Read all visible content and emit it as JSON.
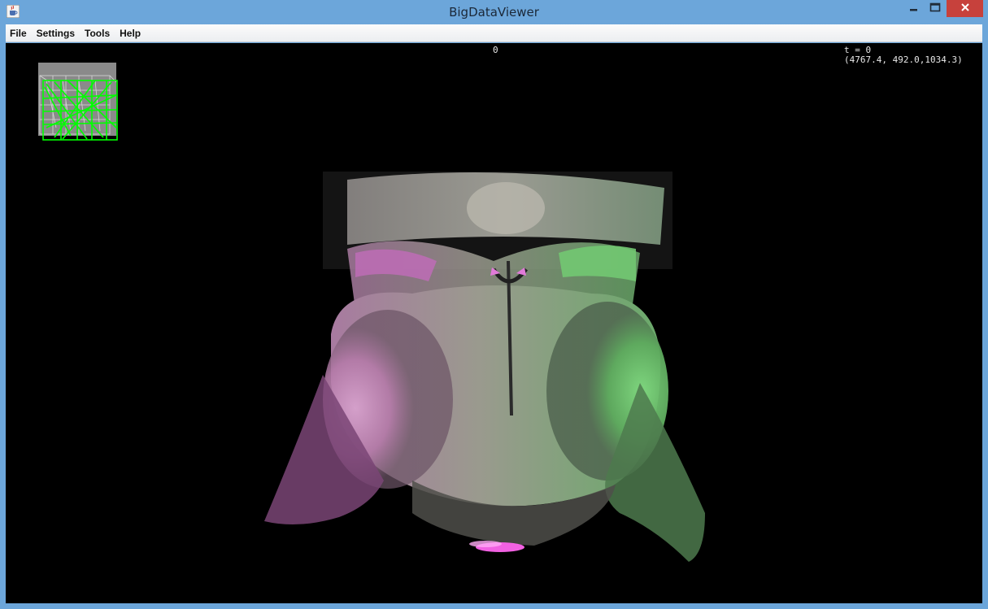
{
  "window": {
    "title": "BigDataViewer",
    "app_icon": "java-cup-icon"
  },
  "controls": {
    "minimize_icon": "minimize-icon",
    "maximize_icon": "maximize-icon",
    "close_icon": "close-icon"
  },
  "menu": {
    "items": [
      {
        "label": "File"
      },
      {
        "label": "Settings"
      },
      {
        "label": "Tools"
      },
      {
        "label": "Help"
      }
    ]
  },
  "viewer": {
    "slice_label": "0",
    "time_label": "t = 0",
    "mouse_coords": "(4767.4, 492.0,1034.3)"
  },
  "colors": {
    "titlebar": "#6ca6da",
    "close_button": "#c7413c",
    "channel_green": "#5fc45f",
    "channel_magenta": "#c77ac0",
    "minimap_box": "#00ff00"
  }
}
